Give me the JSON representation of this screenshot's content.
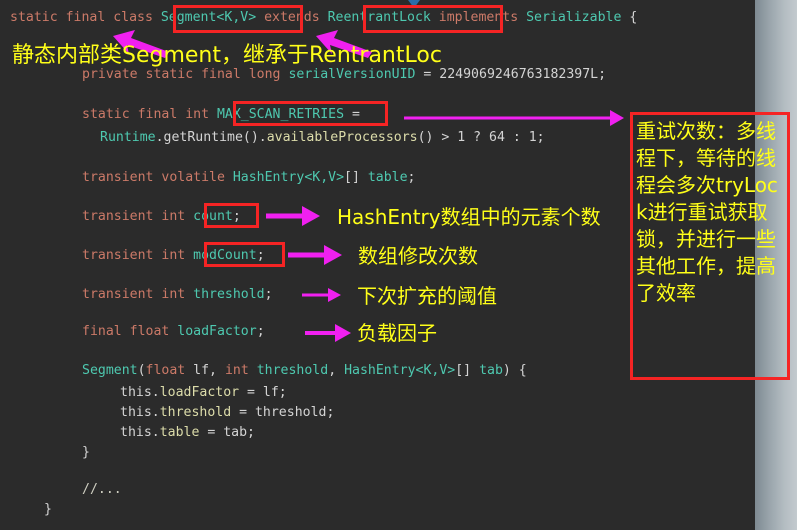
{
  "editor": {
    "background": "#2b2b2b",
    "keyword_color": "#cc7a68",
    "type_color": "#4ec9b0",
    "identifier_color": "#dcdcaa",
    "plain_color": "#d4d4d4",
    "annotation_color": "#ffff19",
    "box_color": "#f52424",
    "arrow_color": "#f020f0"
  },
  "code": {
    "lines": [
      {
        "indent": 0,
        "text": "static final class Segment<K,V> extends ReentrantLock implements Serializable {"
      },
      {
        "indent": 0,
        "text": "private static final long serialVersionUID = 2249069246763182397L;"
      },
      {
        "indent": 0,
        "text": "static final int MAX_SCAN_RETRIES ="
      },
      {
        "indent": 0,
        "text": "Runtime.getRuntime().availableProcessors() > 1 ? 64 : 1;"
      },
      {
        "indent": 0,
        "text": "transient volatile HashEntry<K,V>[] table;"
      },
      {
        "indent": 0,
        "text": "transient int count;"
      },
      {
        "indent": 0,
        "text": "transient int modCount;"
      },
      {
        "indent": 0,
        "text": "transient int threshold;"
      },
      {
        "indent": 0,
        "text": "final float loadFactor;"
      },
      {
        "indent": 0,
        "text": "Segment(float lf, int threshold, HashEntry<K,V>[] tab) {"
      },
      {
        "indent": 0,
        "text": "this.loadFactor = lf;"
      },
      {
        "indent": 0,
        "text": "this.threshold = threshold;"
      },
      {
        "indent": 0,
        "text": "this.table = tab;"
      },
      {
        "indent": 0,
        "text": "}"
      },
      {
        "indent": 0,
        "text": "//..."
      },
      {
        "indent": 0,
        "text": "}"
      }
    ],
    "tokens": {
      "l1_kw1": "static final class ",
      "l1_type1": "Segment<K,V>",
      "l1_kw2": " extends ",
      "l1_type2": "ReentrantLock",
      "l1_kw3": " implements ",
      "l1_type3": "Serializable",
      "l1_brace": " {",
      "l2_kw": "private static final long ",
      "l2_id": "serialVersionUID",
      "l2_rest": " = 2249069246763182397L;",
      "l3_kw": "static final int ",
      "l3_id": "MAX_SCAN_RETRIES",
      "l3_rest": " =",
      "l4_a": "Runtime",
      "l4_b": ".getRuntime().",
      "l4_c": "availableProcessors",
      "l4_d": "() > 1 ? 64 : 1;",
      "l5_kw": "transient volatile ",
      "l5_type": "HashEntry<K,V>",
      "l5_rest": "[] ",
      "l5_id": "table",
      "l5_semi": ";",
      "l6_kw": "transient int ",
      "l6_id": "count",
      "l6_semi": ";",
      "l7_kw": "transient int ",
      "l7_id": "modCount",
      "l7_semi": ";",
      "l8_kw": "transient int ",
      "l8_id": "threshold",
      "l8_semi": ";",
      "l9_kw": "final float ",
      "l9_id": "loadFactor",
      "l9_semi": ";",
      "l10_name": "Segment",
      "l10_p1": "(",
      "l10_kw1": "float",
      "l10_v1": " lf, ",
      "l10_kw2": "int",
      "l10_v2": " ",
      "l10_v2b": "threshold",
      "l10_v3": ", ",
      "l10_type": "HashEntry<K,V>",
      "l10_v4": "[] ",
      "l10_v5": "tab",
      "l10_v6": ") {",
      "l11_this": "this.",
      "l11_f": "loadFactor",
      "l11_rest": " = lf;",
      "l12_this": "this.",
      "l12_f": "threshold",
      "l12_rest": " = threshold;",
      "l13_this": "this.",
      "l13_f": "table",
      "l13_rest": " = tab;",
      "l14": "}",
      "l15": "//...",
      "l16": "}"
    }
  },
  "highlights": [
    {
      "name": "segment-class-name",
      "label": "Segment<K,V>"
    },
    {
      "name": "reentrantlock-superclass",
      "label": "ReentrantLock"
    },
    {
      "name": "max-scan-retries-field",
      "label": "MAX_SCAN_RETRIES"
    },
    {
      "name": "count-field",
      "label": "count"
    },
    {
      "name": "modcount-field",
      "label": "modCount"
    }
  ],
  "annotations": {
    "top": "静态内部类Segment，继承于RentrantLoc",
    "count": "HashEntry数组中的元素个数",
    "modcount": "数组修改次数",
    "threshold": "下次扩充的阈值",
    "loadfactor": "负载因子",
    "right_box": "重试次数：多线程下，等待的线程会多次tryLock进行重试获取锁，并进行一些其他工作，提高了效率"
  }
}
